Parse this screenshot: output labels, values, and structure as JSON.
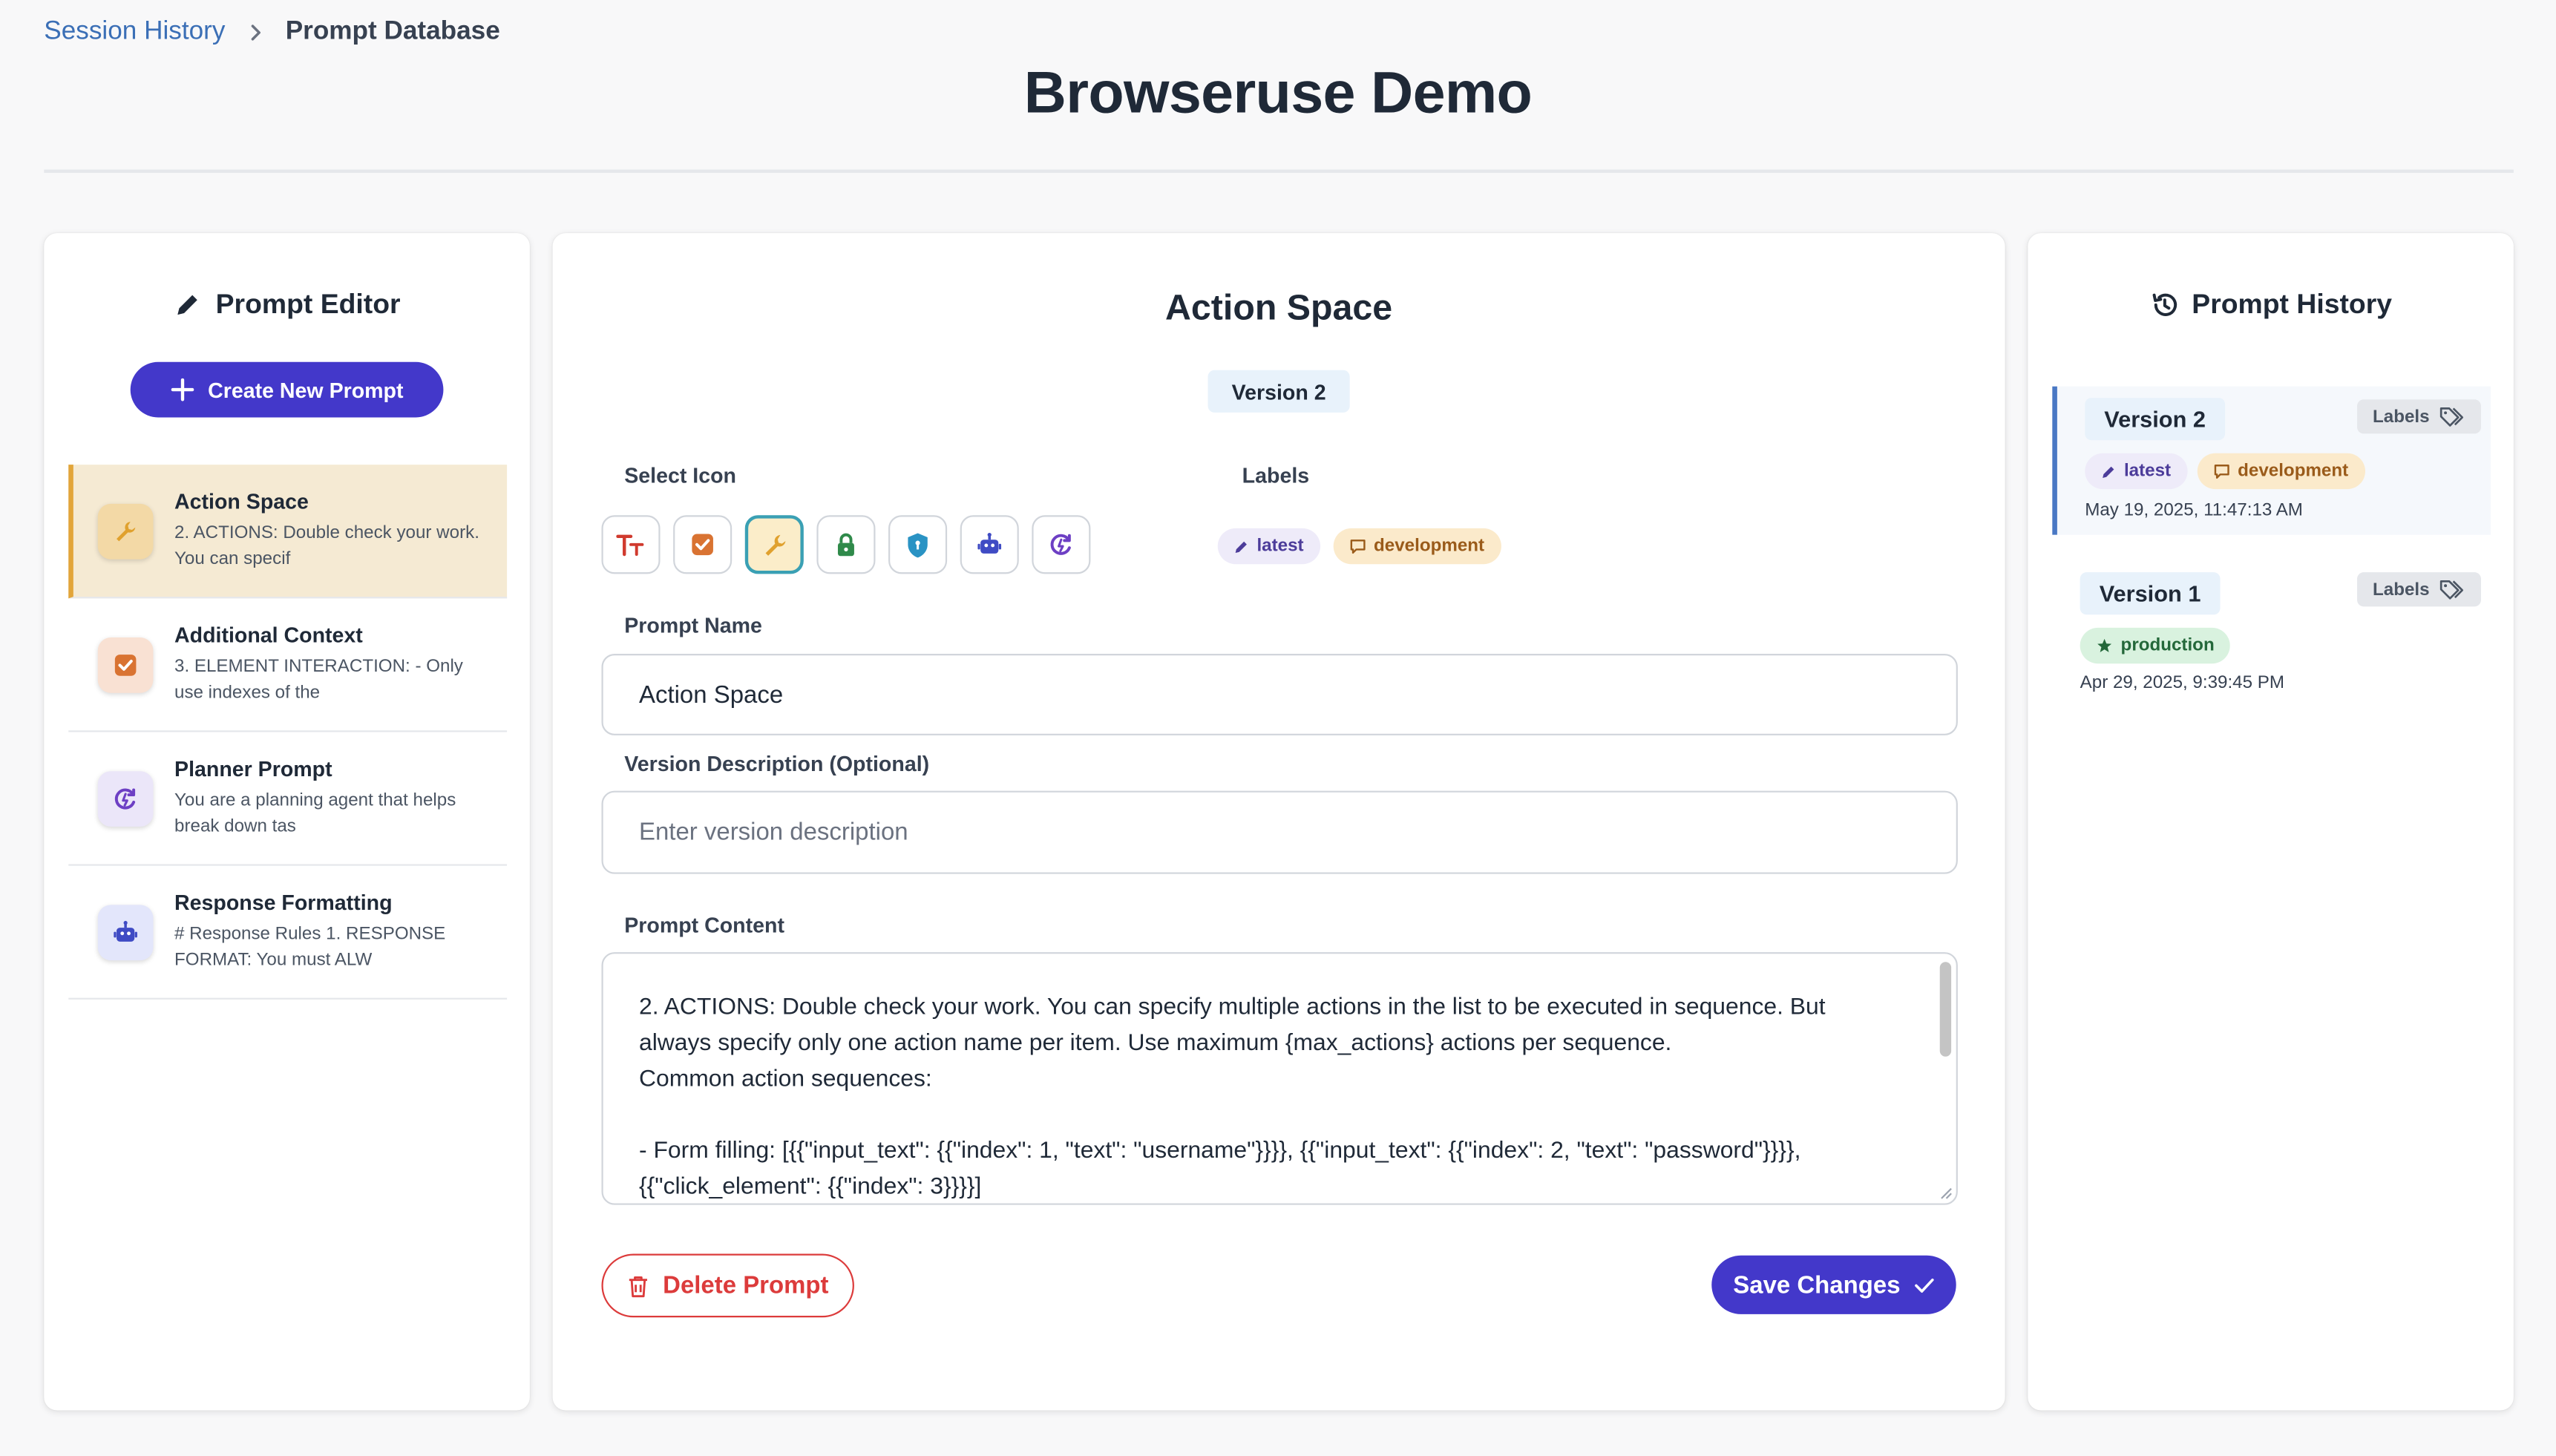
{
  "breadcrumb": {
    "link": "Session History",
    "current": "Prompt Database"
  },
  "page_title": "Browseruse Demo",
  "editor": {
    "heading": "Prompt Editor",
    "create_button": "Create New Prompt",
    "prompts": [
      {
        "title": "Action Space",
        "desc": "2. ACTIONS: Double check your work. You can specif",
        "icon": "wrench-icon",
        "active": true
      },
      {
        "title": "Additional Context",
        "desc": "3. ELEMENT INTERACTION: - Only use indexes of the",
        "icon": "checkbox-icon",
        "active": false
      },
      {
        "title": "Planner Prompt",
        "desc": "You are a planning agent that helps break down tas",
        "icon": "cycle-icon",
        "active": false
      },
      {
        "title": "Response Formatting",
        "desc": "# Response Rules 1. RESPONSE FORMAT: You must ALW",
        "icon": "robot-icon",
        "active": false
      }
    ]
  },
  "main": {
    "title": "Action Space",
    "version": "Version 2",
    "select_icon_label": "Select Icon",
    "labels_label": "Labels",
    "icons": [
      "text-icon",
      "checkbox-icon",
      "wrench-icon",
      "lock-icon",
      "shield-icon",
      "robot-icon",
      "cycle-icon"
    ],
    "selected_icon": "wrench-icon",
    "labels": [
      {
        "text": "latest",
        "icon": "pencil-icon"
      },
      {
        "text": "development",
        "icon": "chat-icon"
      }
    ],
    "name_label": "Prompt Name",
    "name_value": "Action Space",
    "desc_label": "Version Description (Optional)",
    "desc_placeholder": "Enter version description",
    "content_label": "Prompt Content",
    "content_lines": [
      "2. ACTIONS: Double check your work. You can specify multiple actions in the list to be executed in sequence. But",
      "always specify only one action name per item. Use maximum {max_actions} actions per sequence.",
      "Common action sequences:",
      "",
      "- Form filling: [{{\"input_text\": {{\"index\": 1, \"text\": \"username\"}}}}, {{\"input_text\": {{\"index\": 2, \"text\": \"password\"}}}},",
      "{{\"click_element\": {{\"index\": 3}}}}]"
    ],
    "delete_button": "Delete Prompt",
    "save_button": "Save Changes"
  },
  "history": {
    "heading": "Prompt History",
    "labels_button": "Labels",
    "versions": [
      {
        "version": "Version 2",
        "tags": [
          {
            "text": "latest",
            "icon": "pencil-icon"
          },
          {
            "text": "development",
            "icon": "chat-icon"
          }
        ],
        "date": "May 19, 2025, 11:47:13 AM",
        "active": true
      },
      {
        "version": "Version 1",
        "tags": [
          {
            "text": "production",
            "icon": "star-icon"
          }
        ],
        "date": "Apr 29, 2025, 9:39:45 PM",
        "active": false
      }
    ]
  },
  "colors": {
    "accent": "#4338ca",
    "danger": "#dc3b3b",
    "active_item_bg": "#f5ead3",
    "active_item_border": "#e2a53a"
  }
}
